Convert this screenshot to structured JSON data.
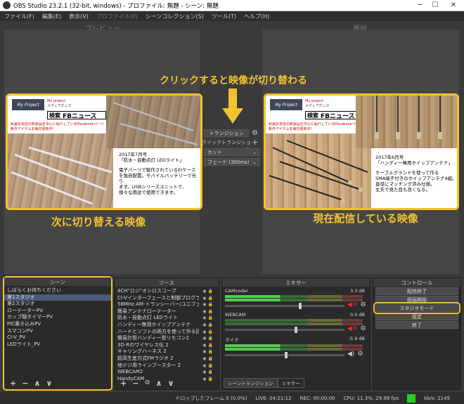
{
  "window": {
    "title": "OBS Studio 23.2.1 (32-bit, windows) - プロファイル: 無題 - シーン: 無題"
  },
  "menu": [
    {
      "label": "ファイル(F)",
      "disabled": false
    },
    {
      "label": "編集(E)",
      "disabled": false
    },
    {
      "label": "表示(V)",
      "disabled": false
    },
    {
      "label": "プロファイル(P)",
      "disabled": true
    },
    {
      "label": "シーンコレクション(S)",
      "disabled": false
    },
    {
      "label": "ツール(T)",
      "disabled": false
    },
    {
      "label": "ヘルプ(H)",
      "disabled": false
    }
  ],
  "panels": {
    "preview": "プレビュー",
    "program": "番組"
  },
  "annotations": {
    "top": "クリックすると映像が切り替わる",
    "left": "次に切り替える映像",
    "right": "現在配信している映像"
  },
  "transition": {
    "transition_btn": "トランジション",
    "quick": "クイックトランジション",
    "cut": "カット",
    "fade": "フェード (300ms)"
  },
  "preview_card": {
    "logo": "My Project",
    "sub1": "My project",
    "sub2": "メディアグッズ",
    "search_label": "検索",
    "search_text": "FBニュース",
    "red_note1": "秋葉原本店の新製品を中心に紹介しているFacebookページ",
    "red_note2": "新作アイテムを毎日更新中!",
    "date": "2017年7月号",
    "product": "「防水・自動点灯 LEDライト」",
    "desc1": "電子パーツで製作されているEIケース",
    "desc2": "を独自配置。モバイルバッテリーで光り",
    "desc3": "ます。USBシリーズユニットで、",
    "desc4": "様々な用途で使用できます。"
  },
  "program_card": {
    "logo": "My Project",
    "sub1": "My project",
    "sub2": "メディアグッズ",
    "search_label": "検索",
    "search_text": "FBニュース",
    "red_note1": "秋葉原本店の新製品を中心に紹介しているFacebookページ",
    "red_note2": "新作アイテムを毎日更新中!",
    "date": "2017年6月号",
    "product": "「ハンディー無用ホイップアンテナ」",
    "desc1": "ケーブルグランドを使って作る",
    "desc2": "SMA端子付きのホイップアンテナ4組。",
    "desc3": "直径にマッチング済み仕様。",
    "desc4": "丈夫で見た目も良くなる。"
  },
  "scenes": {
    "title": "シーン",
    "items": [
      "しばらくお待ちください",
      "第1スタジオ",
      "第2スタジオ",
      "ローテーターPV",
      "カップ麺タイマーPV",
      "PIC書き込みPV",
      "スマコンPV",
      "CI-V_PV",
      "LEDライト_PV"
    ],
    "selected": 1
  },
  "sources": {
    "title": "ソース",
    "items": [
      "4CH\"ロジ\"オシロスコープ",
      "CI-Vインターフェースと制御プログラム",
      "58MHz AM-トランシーバー/ユニフェア向け作品",
      "簡易アンテナローテーター",
      "防水・自動点灯 LEDライト",
      "ハンディー無用ホイップアンテナ",
      "ハードとソフトの両方を使って作る回路",
      "簡易計型ハンディー型リモコン2",
      "3D-Rのワイヤレス化 2",
      "キャリングハーネス 2",
      "超高生産方式FMラジオ 2",
      "地デジ用ラインブースター 2",
      "WEBCAM2",
      "HandyCAM"
    ]
  },
  "mixer": {
    "title": "ミキサー",
    "channels": [
      {
        "name": "CAMcoder",
        "db": "3.3 dB",
        "level": 0.62
      },
      {
        "name": "WEBCAM",
        "db": "0.0 dB",
        "level": 0.58
      },
      {
        "name": "マイク",
        "db": "-5.9 dB",
        "level": 0.5
      }
    ],
    "tabs": [
      "シーントランジション",
      "ミキサー"
    ]
  },
  "controls": {
    "title": "コントロール",
    "buttons": [
      "配信終了",
      "録画開始",
      "スタジオモード",
      "設定",
      "終了"
    ]
  },
  "status": {
    "dropped": "ドロップしたフレーム 0 (0.0%)",
    "live": "LIVE: 04:21:12",
    "rec": "REC: 00:00:00",
    "cpu": "CPU: 11.3%, 29.98 fps",
    "kbps": "kb/s: 2149"
  },
  "colors": {
    "accent": "#f2c230",
    "ok": "#22d022"
  }
}
